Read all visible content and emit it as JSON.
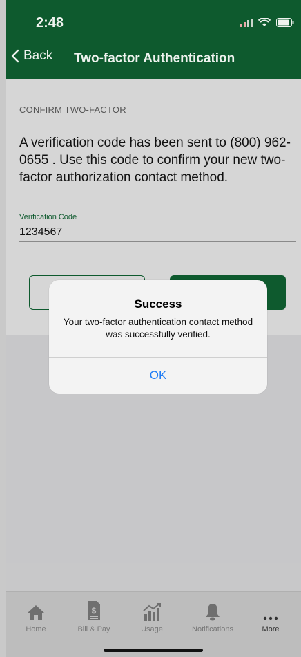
{
  "status_bar": {
    "time": "2:48"
  },
  "nav": {
    "back_label": "Back",
    "title": "Two-factor Authentication"
  },
  "section": {
    "label": "CONFIRM TWO-FACTOR"
  },
  "message": "A verification code has been sent to (800) 962-0655 . Use this code to confirm your new two-factor authorization contact method.",
  "field": {
    "label": "Verification Code",
    "value": "1234567"
  },
  "alert": {
    "title": "Success",
    "message": "Your two-factor authentication contact method was successfully verified.",
    "ok_label": "OK"
  },
  "tabs": [
    {
      "label": "Home",
      "icon": "home-icon"
    },
    {
      "label": "Bill & Pay",
      "icon": "bill-icon"
    },
    {
      "label": "Usage",
      "icon": "usage-chart-icon"
    },
    {
      "label": "Notifications",
      "icon": "bell-icon"
    },
    {
      "label": "More",
      "icon": "more-dots-icon"
    }
  ],
  "colors": {
    "brand_green": "#0e5a2e",
    "ios_blue": "#1e7cf5"
  }
}
